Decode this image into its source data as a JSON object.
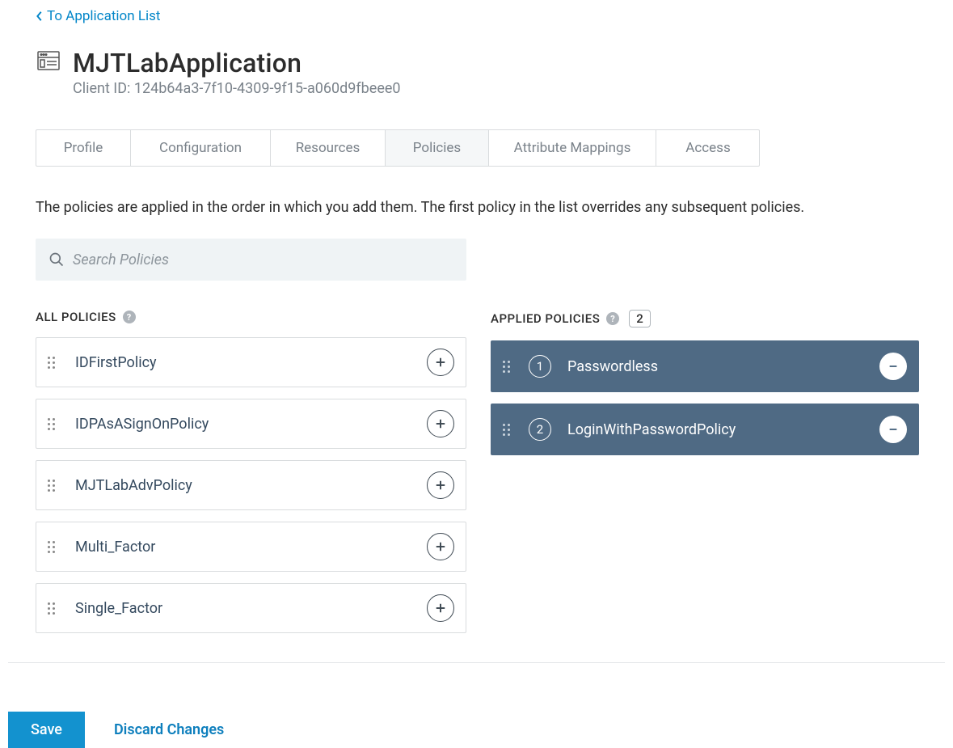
{
  "back_link": {
    "label": "To Application List"
  },
  "app": {
    "name": "MJTLabApplication",
    "client_id_label": "Client ID: 124b64a3-7f10-4309-9f15-a060d9fbeee0"
  },
  "tabs": [
    {
      "label": "Profile"
    },
    {
      "label": "Configuration"
    },
    {
      "label": "Resources"
    },
    {
      "label": "Policies",
      "active": true
    },
    {
      "label": "Attribute Mappings"
    },
    {
      "label": "Access"
    }
  ],
  "description": "The policies are applied in the order in which you add them. The first policy in the list overrides any subsequent policies.",
  "search": {
    "placeholder": "Search Policies",
    "value": ""
  },
  "all_policies": {
    "header": "ALL POLICIES",
    "items": [
      {
        "name": "IDFirstPolicy"
      },
      {
        "name": "IDPAsASignOnPolicy"
      },
      {
        "name": "MJTLabAdvPolicy"
      },
      {
        "name": "Multi_Factor"
      },
      {
        "name": "Single_Factor"
      }
    ]
  },
  "applied_policies": {
    "header": "APPLIED POLICIES",
    "count": "2",
    "items": [
      {
        "rank": "1",
        "name": "Passwordless"
      },
      {
        "rank": "2",
        "name": "LoginWithPasswordPolicy"
      }
    ]
  },
  "actions": {
    "save": "Save",
    "discard": "Discard Changes"
  }
}
